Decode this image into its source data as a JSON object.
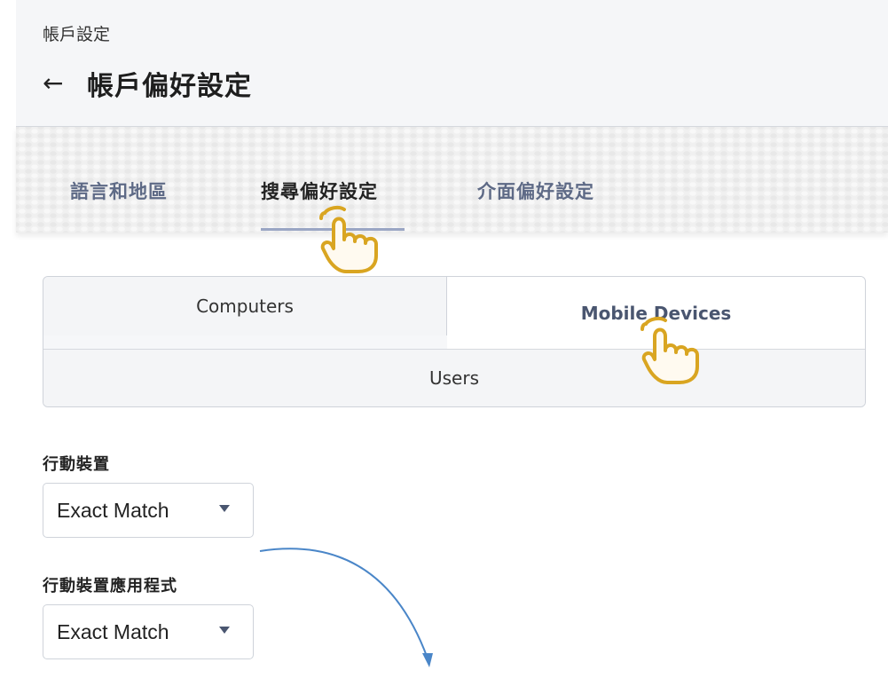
{
  "header": {
    "breadcrumb": "帳戶設定",
    "back_arrow": "←",
    "title": "帳戶偏好設定"
  },
  "tabs": [
    {
      "label": "語言和地區",
      "active": false
    },
    {
      "label": "搜尋偏好設定",
      "active": true
    },
    {
      "label": "介面偏好設定",
      "active": false
    }
  ],
  "segments": {
    "computers": "Computers",
    "mobile_devices": "Mobile Devices",
    "users": "Users",
    "selected": "Mobile Devices"
  },
  "fields": [
    {
      "label": "行動裝置",
      "value": "Exact Match"
    },
    {
      "label": "行動裝置應用程式",
      "value": "Exact Match"
    }
  ],
  "icons": {
    "pointer": "hand-pointer-icon",
    "caret": "caret-down-icon"
  },
  "colors": {
    "accent": "#9aa6c4",
    "pointer_hand": "#d9a521",
    "annotation_arrow": "#4a86c8"
  }
}
